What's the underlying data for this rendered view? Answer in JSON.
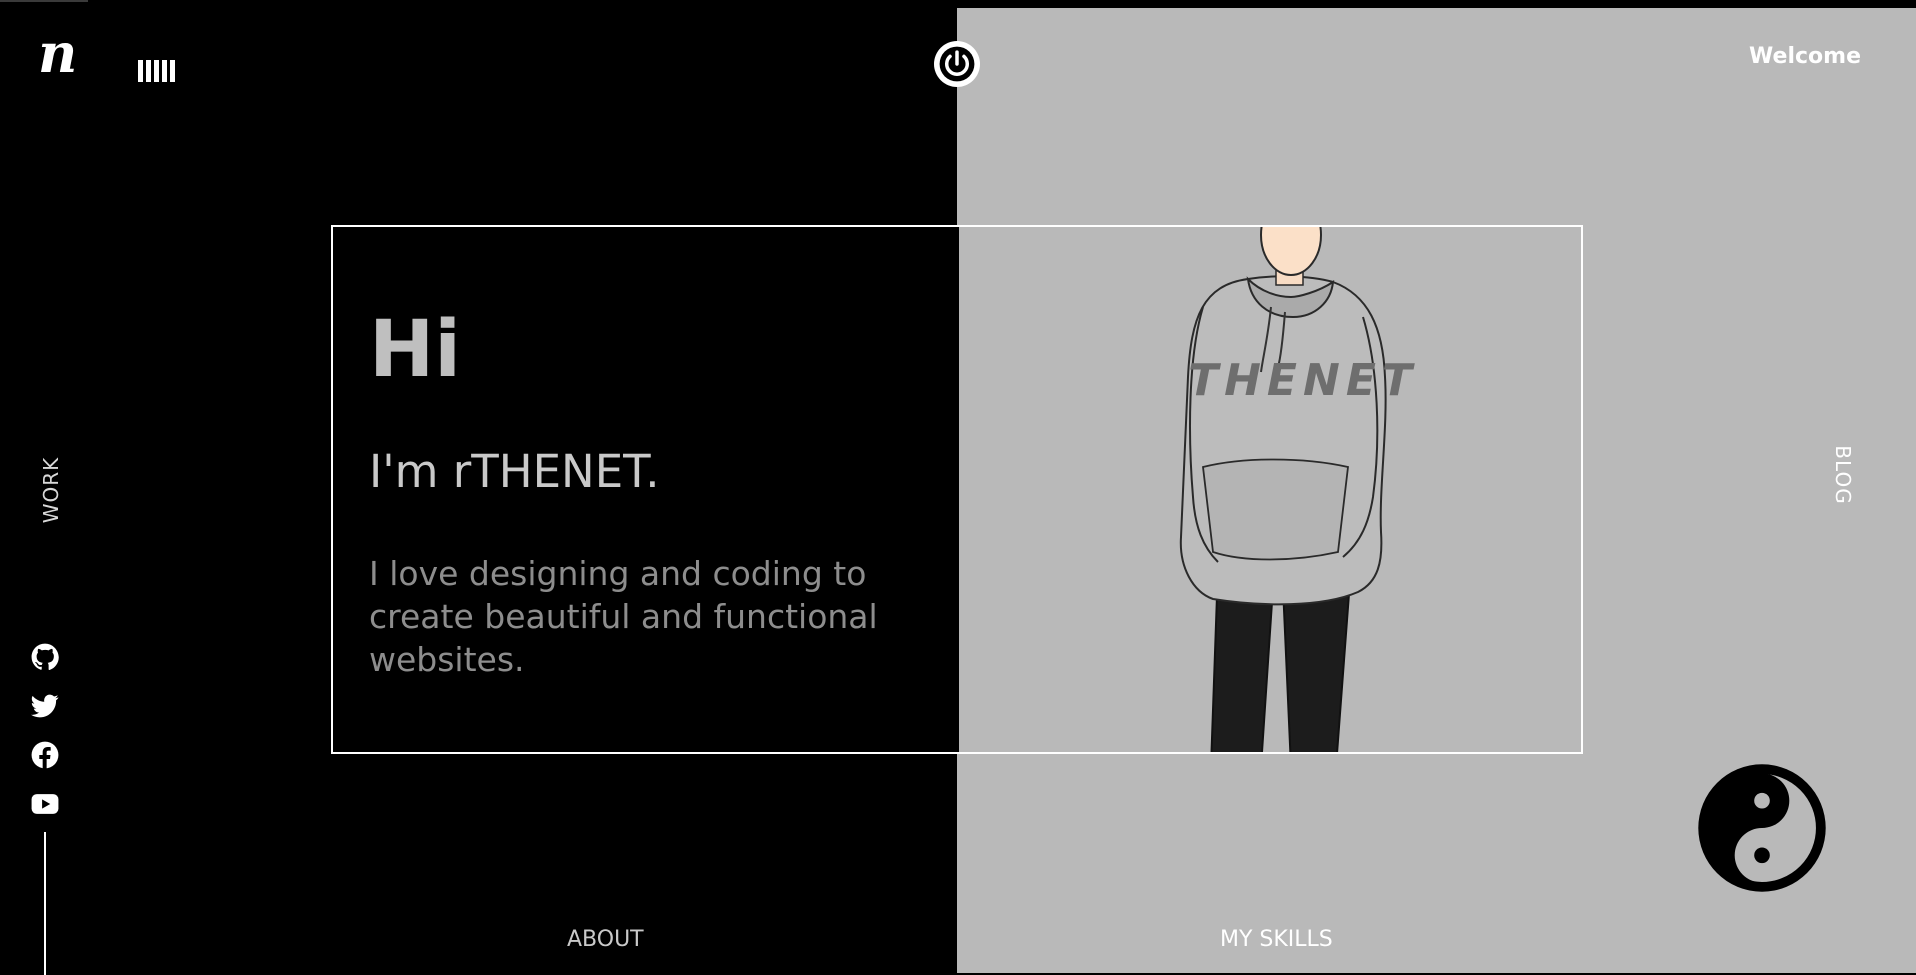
{
  "header": {
    "logo": "n",
    "welcome": "Welcome"
  },
  "nav": {
    "work": "WORK",
    "blog": "BLOG",
    "about": "ABOUT",
    "skills": "MY SKILLS"
  },
  "hero": {
    "greeting": "Hi",
    "intro": "I'm rTHENET.",
    "description": "I love designing and coding to create beautiful and functional websites.",
    "overlay_text": "THENET"
  },
  "socials": [
    {
      "name": "github-icon"
    },
    {
      "name": "twitter-icon"
    },
    {
      "name": "facebook-icon"
    },
    {
      "name": "youtube-icon"
    }
  ],
  "colors": {
    "dark": "#000000",
    "light": "#b9b9b9",
    "accent": "#ffffff"
  }
}
